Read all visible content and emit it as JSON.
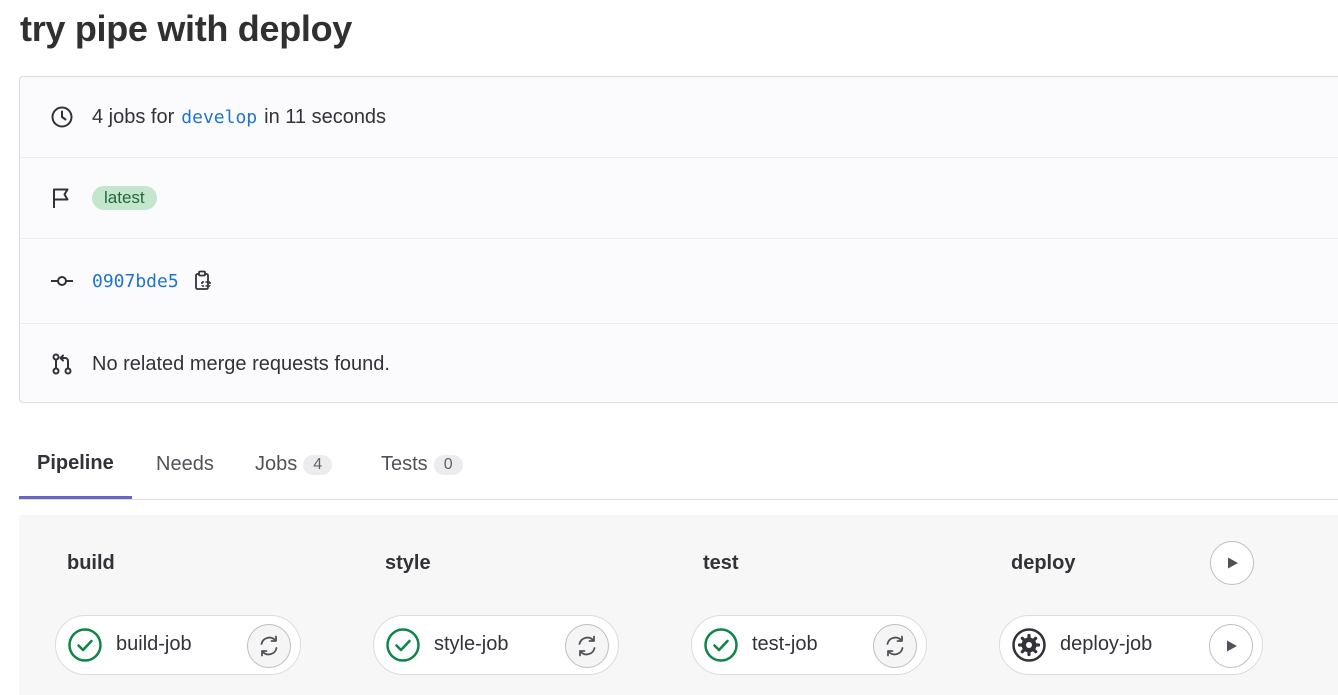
{
  "page": {
    "title": "try pipe with deploy"
  },
  "summary": {
    "jobs_prefix": "4 jobs for",
    "branch": "develop",
    "duration_text": "in 11 seconds",
    "tag": "latest",
    "commit_sha": "0907bde5",
    "merge_requests_text": "No related merge requests found."
  },
  "tabs": [
    {
      "label": "Pipeline",
      "active": true
    },
    {
      "label": "Needs"
    },
    {
      "label": "Jobs",
      "count": "4"
    },
    {
      "label": "Tests",
      "count": "0"
    }
  ],
  "stages": [
    {
      "name": "build",
      "job": {
        "name": "build-job",
        "status": "success",
        "action": "retry"
      }
    },
    {
      "name": "style",
      "job": {
        "name": "style-job",
        "status": "success",
        "action": "retry"
      }
    },
    {
      "name": "test",
      "job": {
        "name": "test-job",
        "status": "success",
        "action": "retry"
      }
    },
    {
      "name": "deploy",
      "stage_action": "play",
      "job": {
        "name": "deploy-job",
        "status": "manual",
        "action": "play"
      }
    }
  ],
  "colors": {
    "success": "#108548",
    "link": "#1f75cb",
    "tab_active_underline": "#6666c4",
    "badge_bg": "#c3e6cd"
  },
  "icons": {
    "duration": "clock-icon",
    "tag": "flag-icon",
    "commit": "commit-icon",
    "merge_request": "merge-request-icon",
    "copy": "clipboard-icon",
    "success": "check-circle-icon",
    "manual": "gear-icon",
    "retry": "retry-icon",
    "play": "play-icon"
  }
}
